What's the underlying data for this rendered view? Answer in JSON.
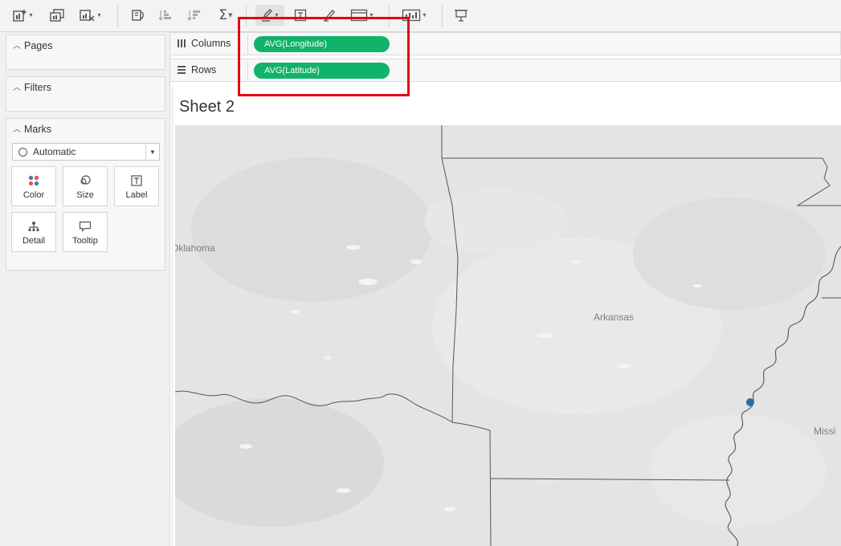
{
  "colors": {
    "pill": "#0fb36a",
    "highlight": "#e30613",
    "map_background": "#e4e4e4",
    "data_point": "#2e6c9c"
  },
  "toolbar": {
    "icons": [
      "add-datasource-icon",
      "duplicate-sheet-icon",
      "clear-sheet-icon",
      "swap-rows-columns-icon",
      "sort-ascending-icon",
      "sort-descending-icon",
      "totals-sum-icon",
      "highlight-pen-icon",
      "text-label-icon",
      "annotate-icon",
      "fit-view-icon",
      "show-me-icon",
      "presentation-icon"
    ],
    "sum_glyph": "Σ"
  },
  "leftpane": {
    "pages_title": "Pages",
    "filters_title": "Filters",
    "marks_title": "Marks",
    "mark_type": "Automatic",
    "mark_buttons": [
      {
        "label": "Color",
        "icon": "color-icon"
      },
      {
        "label": "Size",
        "icon": "size-icon"
      },
      {
        "label": "Label",
        "icon": "label-icon"
      },
      {
        "label": "Detail",
        "icon": "detail-icon"
      },
      {
        "label": "Tooltip",
        "icon": "tooltip-icon"
      }
    ]
  },
  "shelves": {
    "columns_label": "Columns",
    "columns_pill": "AVG(Longitude)",
    "rows_label": "Rows",
    "rows_pill": "AVG(Latitude)"
  },
  "view": {
    "sheet_title": "Sheet 2",
    "map_labels": {
      "oklahoma": "Oklahoma",
      "arkansas": "Arkansas",
      "mississippi": "Missi"
    }
  }
}
